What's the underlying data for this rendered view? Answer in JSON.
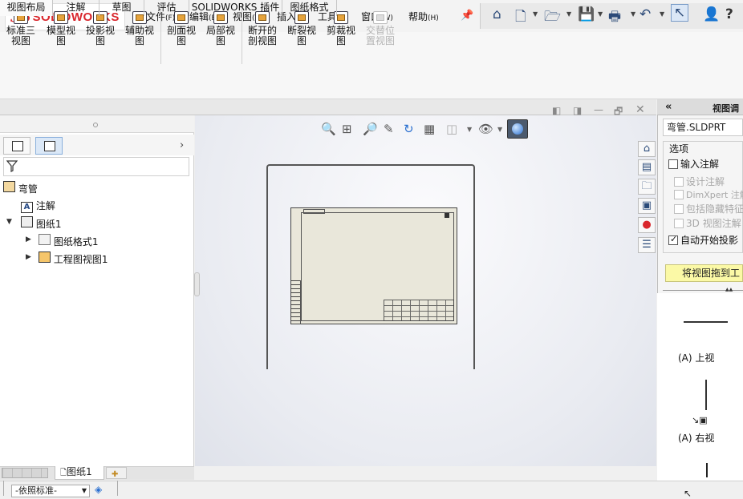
{
  "app": {
    "logo_prefix": "3S",
    "logo_name": "SOLIDWORKS"
  },
  "menu": [
    {
      "label": "文件",
      "key": "(F)"
    },
    {
      "label": "编辑",
      "key": "(E)"
    },
    {
      "label": "视图",
      "key": "(V)"
    },
    {
      "label": "插入",
      "key": "(I)"
    },
    {
      "label": "工具",
      "key": "(T)"
    },
    {
      "label": "窗口",
      "key": "(W)"
    },
    {
      "label": "帮助",
      "key": "(H)"
    }
  ],
  "quick_access": [
    "home-icon",
    "new-document-icon",
    "open-folder-icon",
    "save-icon",
    "print-icon",
    "undo-icon",
    "select-pointer-icon",
    "user-icon",
    "help-icon"
  ],
  "commands": [
    {
      "line1": "标准三",
      "line2": "视图",
      "enabled": true
    },
    {
      "line1": "模型视",
      "line2": "图",
      "enabled": true
    },
    {
      "line1": "投影视",
      "line2": "图",
      "enabled": true
    },
    {
      "line1": "辅助视",
      "line2": "图",
      "enabled": true
    },
    {
      "line1": "剖面视",
      "line2": "图",
      "enabled": true
    },
    {
      "line1": "局部视",
      "line2": "图",
      "enabled": true
    },
    {
      "line1": "断开的",
      "line2": "剖视图",
      "enabled": true
    },
    {
      "line1": "断裂视",
      "line2": "图",
      "enabled": true
    },
    {
      "line1": "剪裁视",
      "line2": "图",
      "enabled": true
    },
    {
      "line1": "交替位",
      "line2": "置视图",
      "enabled": false
    }
  ],
  "tabs": [
    "视图布局",
    "注解",
    "草图",
    "评估",
    "SOLIDWORKS 插件",
    "图纸格式"
  ],
  "feature_tree": {
    "root": "弯管",
    "annotations": "注解",
    "sheet": "图纸1",
    "sheet_format": "图纸格式1",
    "drawing_view": "工程图视图1"
  },
  "sheet_tabs": {
    "active": "图纸1"
  },
  "status": {
    "standard": "-依照标准-"
  },
  "property_manager": {
    "title": "视图调",
    "part": "弯管.SLDPRT",
    "options_label": "选项",
    "options": [
      {
        "label": "输入注解",
        "checked": false,
        "enabled": true,
        "indent": false
      },
      {
        "label": "设计注解",
        "checked": false,
        "enabled": false,
        "indent": true
      },
      {
        "label": "DimXpert 注解",
        "checked": false,
        "enabled": false,
        "indent": true
      },
      {
        "label": "包括隐藏特征",
        "checked": false,
        "enabled": false,
        "indent": true
      },
      {
        "label": "3D 视图注解",
        "checked": false,
        "enabled": false,
        "indent": true
      },
      {
        "label": "自动开始投影",
        "checked": true,
        "enabled": true,
        "indent": false
      }
    ],
    "message": "将视图拖到工",
    "views": [
      "(A) 上视",
      "(A) 右视"
    ]
  },
  "colors": {
    "accent": "#2a6fd0",
    "brand_red": "#d9262c",
    "message_bg": "#fbf9a6",
    "sheet_fill": "#e9e7da"
  }
}
